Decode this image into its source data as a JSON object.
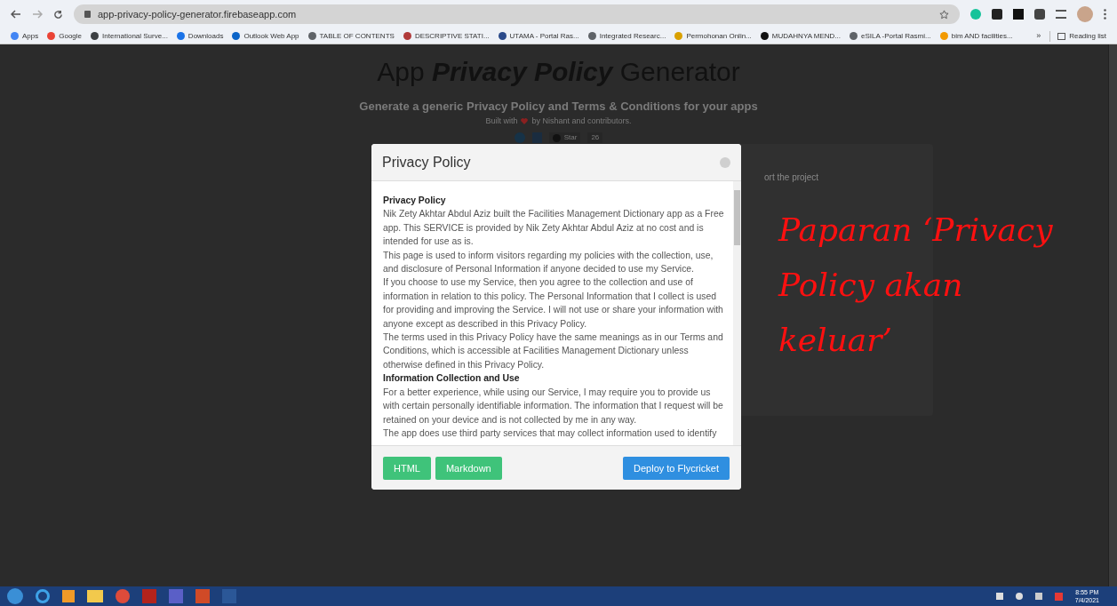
{
  "browser": {
    "url": "app-privacy-policy-generator.firebaseapp.com",
    "bookmarks": [
      {
        "label": "Apps",
        "color": "#4285f4"
      },
      {
        "label": "Google",
        "color": "#ea4335"
      },
      {
        "label": "International Surve...",
        "color": "#3c4043"
      },
      {
        "label": "Downloads",
        "color": "#1a73e8"
      },
      {
        "label": "Outlook Web App",
        "color": "#0a64c8"
      },
      {
        "label": "TABLE OF CONTENTS",
        "color": "#5f6368"
      },
      {
        "label": "DESCRIPTIVE STATI...",
        "color": "#b03a3a"
      },
      {
        "label": "UTAMA - Portal Ras...",
        "color": "#2a4a8a"
      },
      {
        "label": "Integrated Researc...",
        "color": "#5f6368"
      },
      {
        "label": "Permohonan Onlin...",
        "color": "#d9a000"
      },
      {
        "label": "MUDAHNYA MEND...",
        "color": "#111111"
      },
      {
        "label": "eSILA -Portal Rasmi...",
        "color": "#5f6368"
      },
      {
        "label": "bim AND facilities...",
        "color": "#f29900"
      }
    ],
    "more": "»",
    "reading_list": "Reading list"
  },
  "page": {
    "title_parts": [
      {
        "text": "App ",
        "italic": false
      },
      {
        "text": "Privacy Policy",
        "italic": true
      },
      {
        "text": " Generator",
        "italic": false
      }
    ],
    "subtitle": "Generate a generic Privacy Policy and Terms & Conditions for your apps",
    "credit_before": "Built with",
    "credit_after": "by Nishant and contributors.",
    "star_label": "Star",
    "star_count": "26",
    "behind_text": "ort the project"
  },
  "modal": {
    "title": "Privacy Policy",
    "paragraphs": [
      {
        "kind": "heading",
        "text": "Privacy Policy"
      },
      {
        "kind": "text",
        "text": "Nik Zety Akhtar Abdul Aziz built the Facilities Management Dictionary app as a Free app. This SERVICE is provided by Nik Zety Akhtar Abdul Aziz at no cost and is intended for use as is."
      },
      {
        "kind": "text",
        "text": "This page is used to inform visitors regarding my policies with the collection, use, and disclosure of Personal Information if anyone decided to use my Service."
      },
      {
        "kind": "text",
        "text": "If you choose to use my Service, then you agree to the collection and use of information in relation to this policy. The Personal Information that I collect is used for providing and improving the Service. I will not use or share your information with anyone except as described in this Privacy Policy."
      },
      {
        "kind": "text",
        "text": "The terms used in this Privacy Policy have the same meanings as in our Terms and Conditions, which is accessible at Facilities Management Dictionary unless otherwise defined in this Privacy Policy."
      },
      {
        "kind": "heading",
        "text": "Information Collection and Use"
      },
      {
        "kind": "text",
        "text": "For a better experience, while using our Service, I may require you to provide us with certain personally identifiable information. The information that I request will be retained on your device and is not collected by me in any way."
      },
      {
        "kind": "text",
        "text": "The app does use third party services that may collect information used to identify"
      }
    ],
    "buttons": [
      {
        "label": "HTML",
        "kind": "green"
      },
      {
        "label": "Markdown",
        "kind": "green"
      },
      {
        "label": "Deploy to Flycricket",
        "kind": "blue"
      }
    ]
  },
  "annotation": {
    "lines": [
      "Paparan ‘Privacy",
      "Policy akan",
      "keluar’"
    ]
  },
  "taskbar": {
    "time": "8:55 PM",
    "date": "7/4/2021"
  }
}
